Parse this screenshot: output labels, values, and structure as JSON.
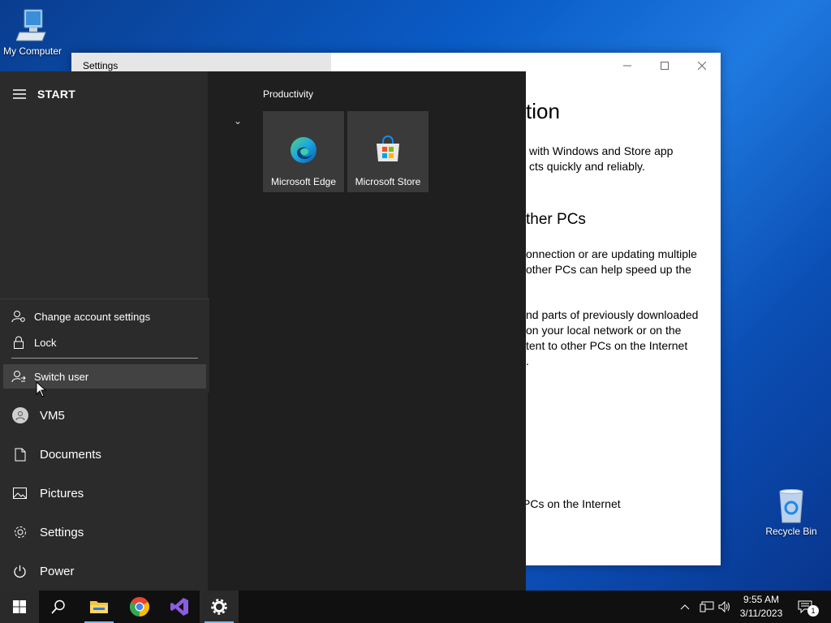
{
  "desktop": {
    "my_computer": "My Computer",
    "recycle_bin": "Recycle Bin"
  },
  "settings_window": {
    "title": "Settings",
    "heading": "tion",
    "para1_line1": "with Windows and Store app",
    "para1_line2": "cts quickly and reliably.",
    "subheading": "ther PCs",
    "para2_line1": "onnection or are updating multiple",
    "para2_line2": "other PCs can help speed up the",
    "para3_line1": "nd parts of previously downloaded",
    "para3_line2": "on your local network or on the",
    "para3_line3": "tent to other PCs on the Internet",
    "para3_line4": ".",
    "option": "PCs on the Internet"
  },
  "start_menu": {
    "header_label": "START",
    "account_flyout": {
      "change_settings": "Change account settings",
      "lock": "Lock",
      "switch_user": "Switch user"
    },
    "nav": {
      "user": "VM5",
      "documents": "Documents",
      "pictures": "Pictures",
      "settings": "Settings",
      "power": "Power"
    },
    "group_title": "Productivity",
    "tiles": {
      "edge": "Microsoft Edge",
      "store": "Microsoft Store"
    }
  },
  "taskbar": {
    "time": "9:55 AM",
    "date": "3/11/2023",
    "notification_count": "1"
  }
}
